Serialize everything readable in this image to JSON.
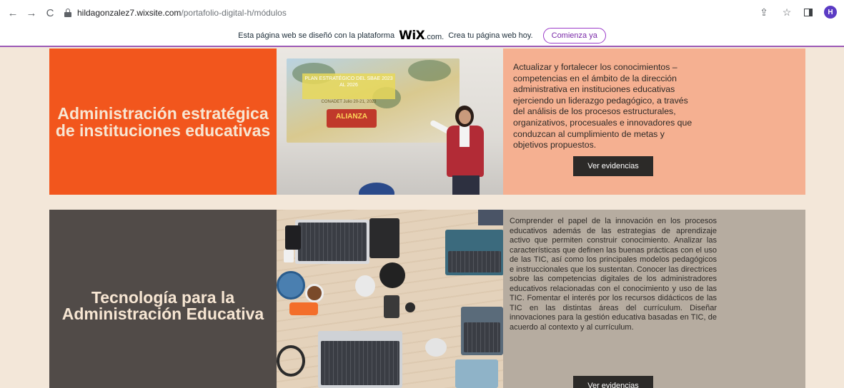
{
  "browser": {
    "url_host": "hildagonzalez7.wixsite.com",
    "url_path": "/portafolio-digital-h/módulos",
    "back_icon": "←",
    "forward_icon": "→",
    "reload_icon": "C",
    "share_icon": "⇪",
    "star_icon": "☆",
    "avatar_letter": "H"
  },
  "wix_banner": {
    "text_before": "Esta página web se diseñó con la plataforma",
    "logo": "WiX",
    "logo_suffix": ".com.",
    "text_after": "Crea tu página web hoy.",
    "cta_label": "Comienza ya"
  },
  "modules": [
    {
      "title": "Administración estratégica de instituciones educativas",
      "description": "Actualizar y fortalecer los conocimientos – competencias en el ámbito de la dirección administrativa en instituciones educativas ejerciendo un liderazgo pedagógico, a través del análisis de los procesos estructurales, organizativos, procesuales e innovadores que conduzcan al cumplimiento de metas y objetivos propuestos.",
      "button_label": "Ver evidencias",
      "photo": {
        "slide_title": "PLAN ESTRATÉGICO DEL SBAE 2023 AL 2026",
        "slide_sub": "CONADET Julio 20-21, 2023",
        "slide_logo": "ALIANZA"
      }
    },
    {
      "title": "Tecnología para la Administración Educativa",
      "description": "Comprender el papel de la innovación en los procesos educativos además de las estrategias de aprendizaje activo que permiten construir conocimiento. Analizar las características que definen las buenas prácticas con el uso de las TIC, así como los principales modelos pedagógicos e instruccionales que los sustentan. Conocer las directrices sobre las competencias digitales de los administradores educativos relacionadas con el conocimiento y uso de las TIC. Fomentar el interés por los recursos didácticos de las TIC en las distintas áreas del currículum. Diseñar innovaciones para la gestión educativa basadas en TIC, de acuerdo al contexto y al currículum.",
      "button_label": "Ver evidencias"
    }
  ],
  "colors": {
    "page_bg": "#f3e7d9",
    "card1_title_bg": "#f2561d",
    "card1_desc_bg": "#f5b091",
    "card2_title_bg": "#514b48",
    "card2_desc_bg": "#b6aca0",
    "title_text": "#f7e6d3",
    "wix_accent": "#9b3bc9"
  }
}
